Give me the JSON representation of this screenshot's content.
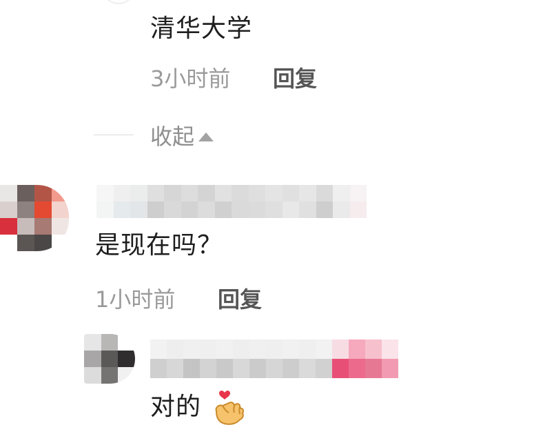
{
  "thread": {
    "reply_top": {
      "text": "清华大学",
      "time": "3小时前",
      "reply_label": "回复"
    },
    "collapse": {
      "label": "收起"
    },
    "comment_main": {
      "text": "是现在吗？",
      "time": "1小时前",
      "reply_label": "回复"
    },
    "reply_bottom": {
      "text": "对的"
    }
  },
  "icons": {
    "collapse": "triangle-up-icon",
    "finger_heart": "finger-heart-emoji"
  },
  "colors": {
    "comment_text": "#1e1e1e",
    "time_text": "#9a9a9a",
    "reply_text": "#555555",
    "collapse_text": "#8e8e8e"
  }
}
